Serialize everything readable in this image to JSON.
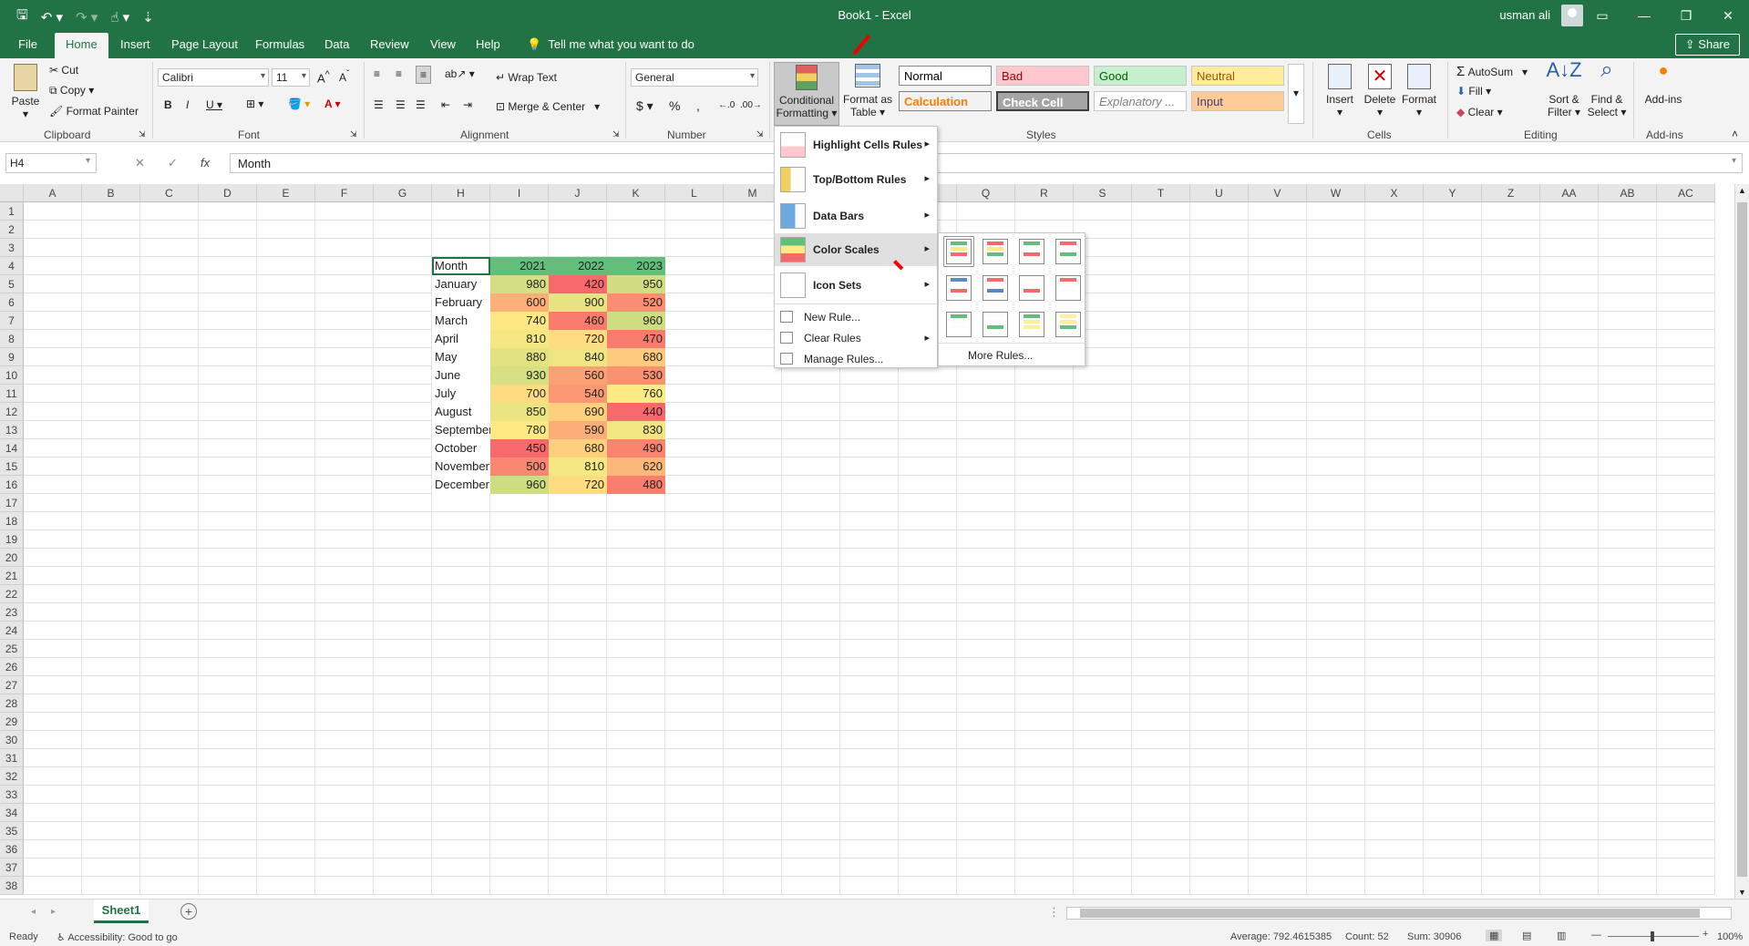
{
  "window": {
    "doc_title": "Book1  -  Excel",
    "user_name": "usman ali"
  },
  "tabs": [
    "File",
    "Home",
    "Insert",
    "Page Layout",
    "Formulas",
    "Data",
    "Review",
    "View",
    "Help"
  ],
  "tell_me": "Tell me what you want to do",
  "share_label": "Share",
  "ribbon": {
    "clipboard": {
      "paste": "Paste",
      "cut": "Cut",
      "copy": "Copy",
      "format_painter": "Format Painter",
      "label": "Clipboard"
    },
    "font": {
      "name": "Calibri",
      "size": "11",
      "label": "Font"
    },
    "alignment": {
      "wrap_text": "Wrap Text",
      "merge_center": "Merge & Center",
      "label": "Alignment"
    },
    "number": {
      "format": "General",
      "label": "Number"
    },
    "styles": {
      "conditional_formatting": "Conditional Formatting",
      "format_as_table": "Format as Table",
      "label": "Styles",
      "cells": [
        {
          "name": "Normal",
          "bg": "#ffffff",
          "fg": "#000000"
        },
        {
          "name": "Bad",
          "bg": "#ffc7ce",
          "fg": "#9c0006"
        },
        {
          "name": "Good",
          "bg": "#c6efce",
          "fg": "#006100"
        },
        {
          "name": "Neutral",
          "bg": "#ffeb9c",
          "fg": "#9c5700"
        },
        {
          "name": "Calculation",
          "bg": "#f2f2f2",
          "fg": "#fa7d00"
        },
        {
          "name": "Check Cell",
          "bg": "#a5a5a5",
          "fg": "#ffffff"
        },
        {
          "name": "Explanatory ...",
          "bg": "#ffffff",
          "fg": "#7f7f7f"
        },
        {
          "name": "Input",
          "bg": "#ffcc99",
          "fg": "#3f3f76"
        }
      ]
    },
    "cells": {
      "insert": "Insert",
      "delete": "Delete",
      "format": "Format",
      "label": "Cells"
    },
    "editing": {
      "autosum": "AutoSum",
      "fill": "Fill",
      "clear": "Clear",
      "sort_filter": "Sort & Filter",
      "find_select": "Find & Select",
      "label": "Editing"
    },
    "addins": {
      "addins": "Add-ins",
      "label": "Add-ins"
    }
  },
  "formula_bar": {
    "name_box": "H4",
    "formula": "Month"
  },
  "columns": [
    "A",
    "B",
    "C",
    "D",
    "E",
    "F",
    "G",
    "H",
    "I",
    "J",
    "K",
    "L",
    "M",
    "N",
    "O",
    "P",
    "Q",
    "R",
    "S",
    "T",
    "U",
    "V",
    "W",
    "X",
    "Y",
    "Z",
    "AA",
    "AB",
    "AC"
  ],
  "table": {
    "header": [
      "Month",
      "2021",
      "2022",
      "2023"
    ],
    "header_color": "#63be7b",
    "rows": [
      {
        "month": "January",
        "v": [
          "980",
          "420",
          "950"
        ],
        "c": [
          "#d3df82",
          "#f8696b",
          "#d0dd82"
        ]
      },
      {
        "month": "February",
        "v": [
          "600",
          "900",
          "520"
        ],
        "c": [
          "#fcaf78",
          "#e9e483",
          "#fa8e72"
        ]
      },
      {
        "month": "March",
        "v": [
          "740",
          "460",
          "960"
        ],
        "c": [
          "#ffe783",
          "#f87b6e",
          "#cfdd82"
        ]
      },
      {
        "month": "April",
        "v": [
          "810",
          "720",
          "470"
        ],
        "c": [
          "#f6e783",
          "#ffdc81",
          "#f97b6e"
        ]
      },
      {
        "month": "May",
        "v": [
          "880",
          "840",
          "680"
        ],
        "c": [
          "#e3e283",
          "#f0e583",
          "#fdcb7d"
        ]
      },
      {
        "month": "June",
        "v": [
          "930",
          "560",
          "530"
        ],
        "c": [
          "#d6df82",
          "#fba176",
          "#fa9272"
        ]
      },
      {
        "month": "July",
        "v": [
          "700",
          "540",
          "760"
        ],
        "c": [
          "#ffdc81",
          "#fb9874",
          "#ffeb84"
        ]
      },
      {
        "month": "August",
        "v": [
          "850",
          "690",
          "440"
        ],
        "c": [
          "#ebe483",
          "#fed07e",
          "#f8696b"
        ]
      },
      {
        "month": "September",
        "v": [
          "780",
          "590",
          "830"
        ],
        "c": [
          "#fee983",
          "#fcae78",
          "#f2e683"
        ]
      },
      {
        "month": "October",
        "v": [
          "450",
          "680",
          "490"
        ],
        "c": [
          "#f8696b",
          "#fdcf7e",
          "#f98470"
        ]
      },
      {
        "month": "November",
        "v": [
          "500",
          "810",
          "620"
        ],
        "c": [
          "#f98771",
          "#f5e783",
          "#fcb87a"
        ]
      },
      {
        "month": "December",
        "v": [
          "960",
          "720",
          "480"
        ],
        "c": [
          "#cfdd82",
          "#ffdc81",
          "#f97e6f"
        ]
      }
    ]
  },
  "cf_menu": {
    "items": [
      {
        "label": "Highlight Cells Rules",
        "submenu": true
      },
      {
        "label": "Top/Bottom Rules",
        "submenu": true
      },
      {
        "label": "Data Bars",
        "submenu": true
      },
      {
        "label": "Color Scales",
        "submenu": true,
        "highlighted": true
      },
      {
        "label": "Icon Sets",
        "submenu": true
      }
    ],
    "small_items": [
      {
        "label": "New Rule...",
        "submenu": false
      },
      {
        "label": "Clear Rules",
        "submenu": true
      },
      {
        "label": "Manage Rules...",
        "submenu": false
      }
    ]
  },
  "color_scales_menu": {
    "more_rules": "More Rules...",
    "scales": [
      [
        "#63be7b",
        "#ffeb84",
        "#f8696b"
      ],
      [
        "#f8696b",
        "#ffeb84",
        "#63be7b"
      ],
      [
        "#63be7b",
        "#fcfcff",
        "#f8696b"
      ],
      [
        "#f8696b",
        "#fcfcff",
        "#63be7b"
      ],
      [
        "#5a8ac6",
        "#fcfcff",
        "#f8696b"
      ],
      [
        "#f8696b",
        "#fcfcff",
        "#5a8ac6"
      ],
      [
        "#fcfcff",
        "#fcfcff",
        "#f8696b"
      ],
      [
        "#f8696b",
        "#fcfcff",
        "#fcfcff"
      ],
      [
        "#63be7b",
        "#fcfcff",
        "#fcfcff"
      ],
      [
        "#fcfcff",
        "#fcfcff",
        "#63be7b"
      ],
      [
        "#63be7b",
        "#ffef9c",
        "#ffef9c"
      ],
      [
        "#ffef9c",
        "#ffef9c",
        "#63be7b"
      ]
    ]
  },
  "sheet_tab": "Sheet1",
  "status": {
    "ready": "Ready",
    "accessibility": "Accessibility: Good to go",
    "average": "Average: 792.4615385",
    "count": "Count: 52",
    "sum": "Sum: 30906",
    "zoom": "100%"
  }
}
